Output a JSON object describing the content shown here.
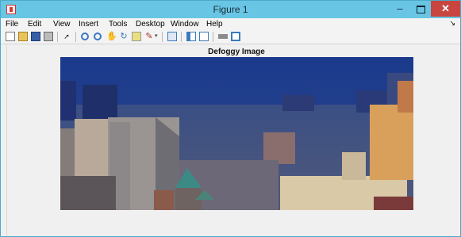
{
  "window": {
    "title": "Figure 1",
    "app_icon": "matlab-figure-icon",
    "controls": {
      "minimize": "–",
      "close": "✕"
    }
  },
  "menubar": {
    "items": [
      "File",
      "Edit",
      "View",
      "Insert",
      "Tools",
      "Desktop",
      "Window",
      "Help"
    ],
    "overflow": "↘"
  },
  "toolbar": {
    "icons": [
      "new-figure-icon",
      "open-file-icon",
      "save-figure-icon",
      "print-figure-icon",
      "edit-plot-icon",
      "zoom-in-icon",
      "zoom-out-icon",
      "pan-icon",
      "rotate-3d-icon",
      "data-cursor-icon",
      "brush-icon",
      "link-plot-icon",
      "insert-colorbar-icon",
      "insert-legend-icon",
      "hide-plot-tools-icon",
      "show-plot-tools-icon"
    ]
  },
  "axes": {
    "title": "Defoggy Image"
  },
  "colors": {
    "titlebar": "#68c6e4",
    "close_button": "#c9453f",
    "image_sky": "#1f3d8f",
    "image_buildings_warm": "#d9a05c"
  }
}
